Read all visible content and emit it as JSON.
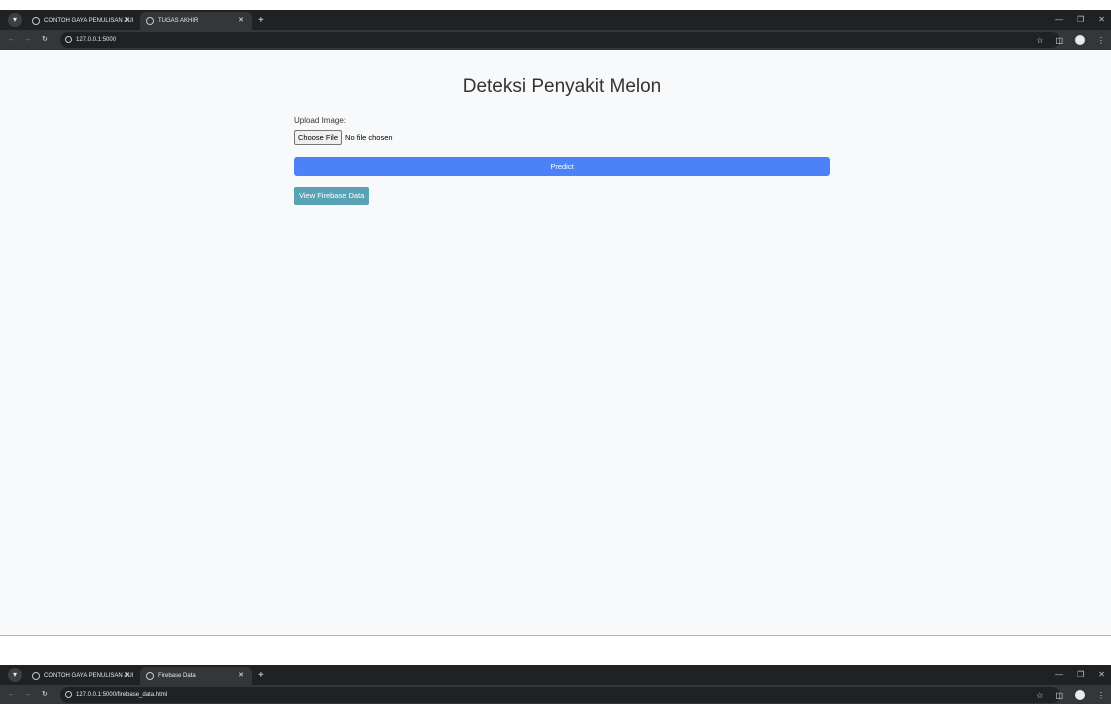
{
  "window1": {
    "tabs": [
      {
        "label": "CONTOH GAYA PENULISAN JUI"
      },
      {
        "label": "TUGAS AKHIR"
      }
    ],
    "url": "127.0.0.1:5000",
    "page": {
      "title": "Deteksi Penyakit Melon",
      "upload_label": "Upload Image:",
      "choose_file_label": "Choose File",
      "no_file_text": "No file chosen",
      "predict_label": "Predict",
      "firebase_label": "View Firebase Data"
    }
  },
  "window2": {
    "tabs": [
      {
        "label": "CONTOH GAYA PENULISAN JUI"
      },
      {
        "label": "Firebase Data"
      }
    ],
    "url": "127.0.0.1:5000/firebase_data.html"
  },
  "colors": {
    "predict_button": "#4c82f7",
    "firebase_button": "#5aa3b6",
    "page_background": "#f8f9fa",
    "chrome_dark": "#202124"
  },
  "icons": {
    "back": "arrow-left-icon",
    "forward": "arrow-right-icon",
    "reload": "reload-icon",
    "bookmark": "star-icon",
    "extensions": "puzzle-icon",
    "profile": "profile-icon"
  }
}
